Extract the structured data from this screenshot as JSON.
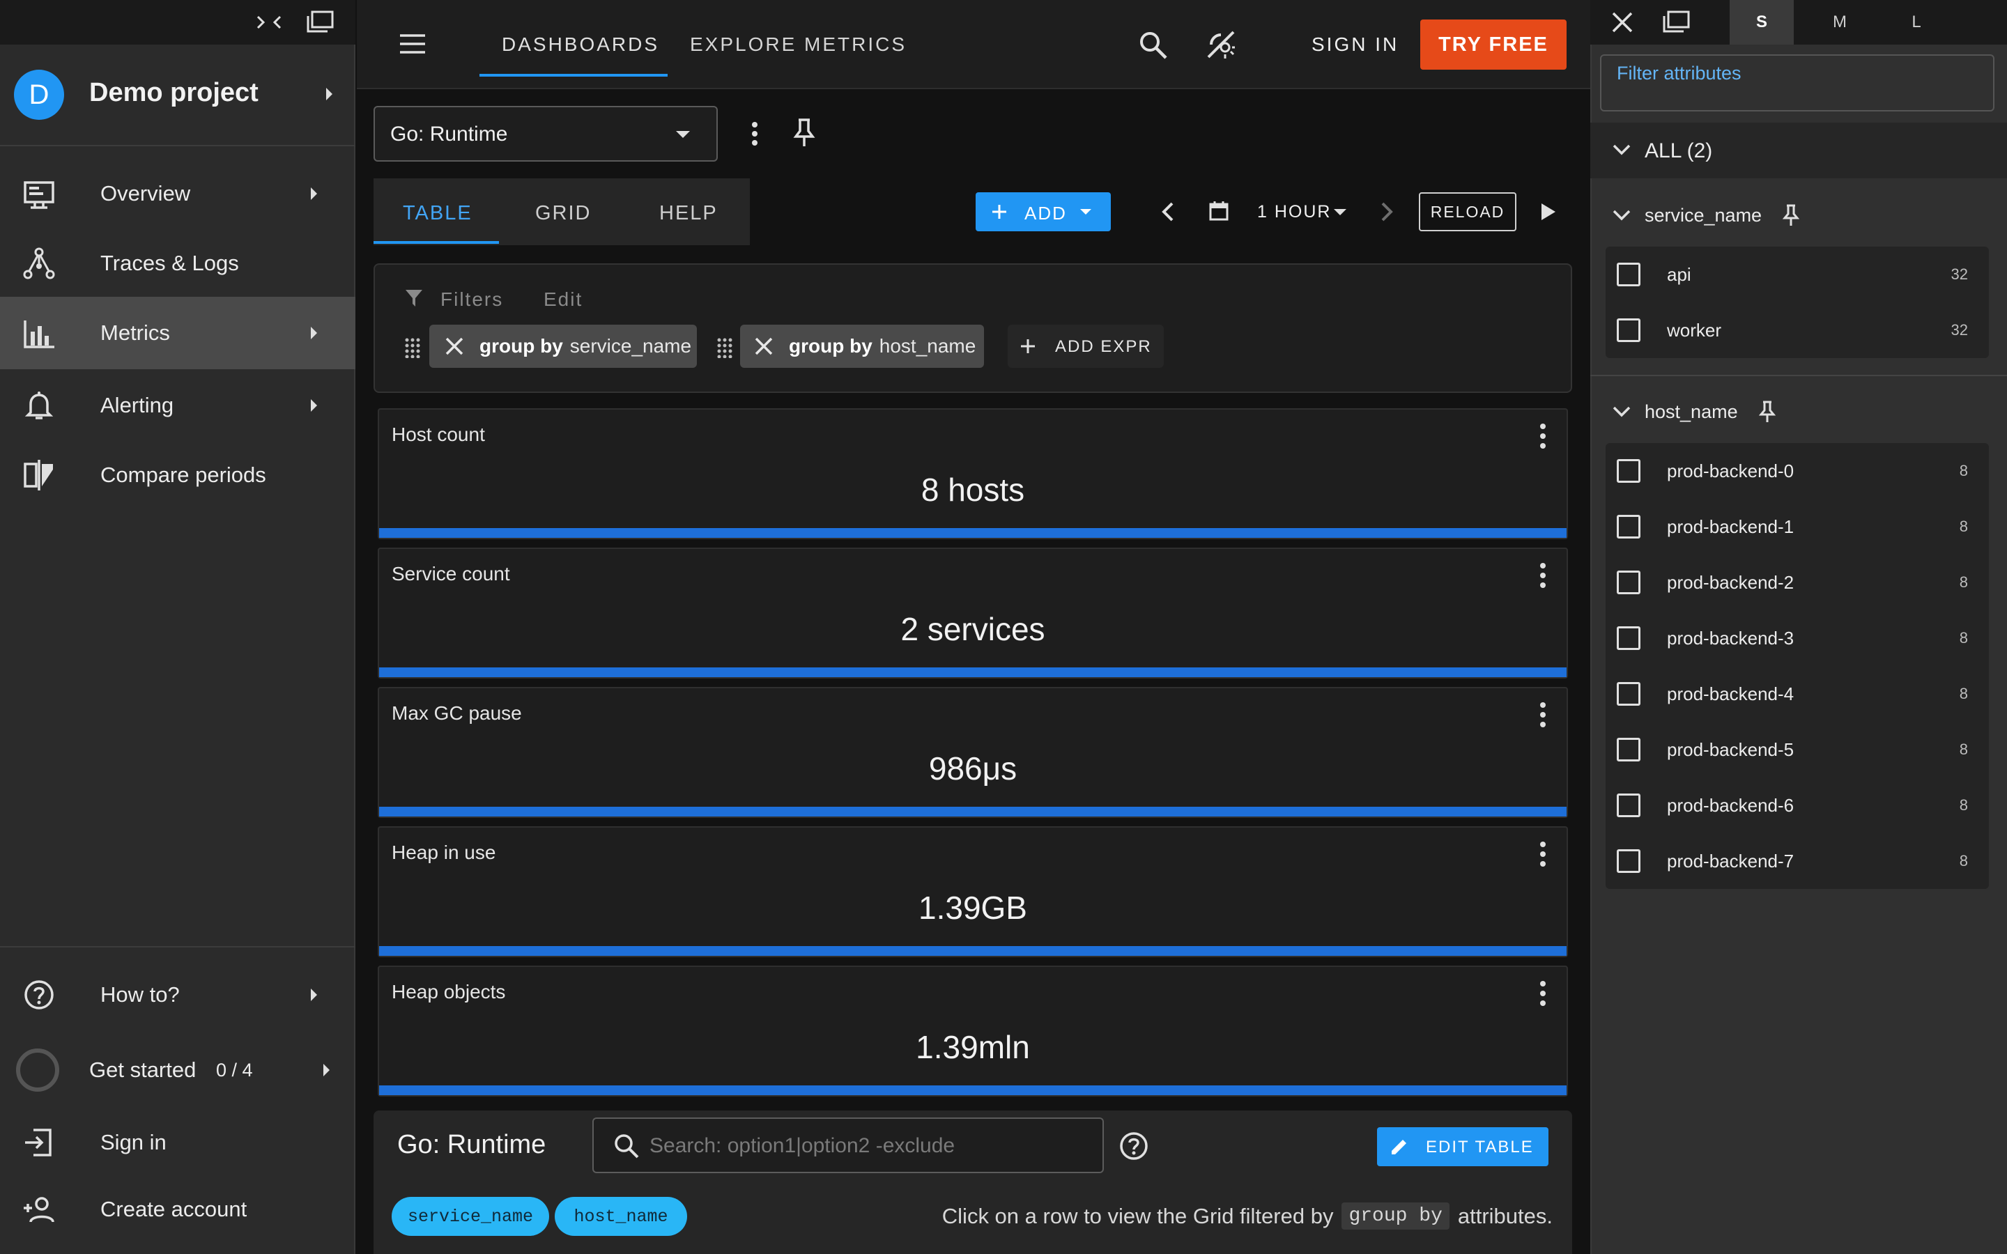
{
  "sidebar": {
    "project_initial": "D",
    "project_name": "Demo project",
    "items": [
      {
        "label": "Overview",
        "icon": "monitor-icon"
      },
      {
        "label": "Traces & Logs",
        "icon": "traces-icon"
      },
      {
        "label": "Metrics",
        "icon": "bar-chart-icon",
        "active": true
      },
      {
        "label": "Alerting",
        "icon": "bell-icon"
      },
      {
        "label": "Compare periods",
        "icon": "compare-icon"
      }
    ],
    "bottom": {
      "how_to": "How to?",
      "get_started": "Get started",
      "get_started_progress": "0 / 4",
      "sign_in": "Sign in",
      "create_account": "Create account"
    }
  },
  "topnav": {
    "tabs": [
      "DASHBOARDS",
      "EXPLORE METRICS"
    ],
    "active_tab": "DASHBOARDS",
    "sign_in": "SIGN IN",
    "try_free": "TRY FREE"
  },
  "dashboard": {
    "selected": "Go: Runtime",
    "view_tabs": [
      "TABLE",
      "GRID",
      "HELP"
    ],
    "active_view": "TABLE",
    "add_label": "ADD",
    "period": "1 HOUR",
    "reload": "RELOAD"
  },
  "filters": {
    "label": "Filters",
    "edit": "Edit",
    "chips": [
      {
        "prefix": "group by",
        "value": "service_name"
      },
      {
        "prefix": "group by",
        "value": "host_name"
      }
    ],
    "add_expr": "ADD EXPR"
  },
  "cards": [
    {
      "title": "Host count",
      "value": "8 hosts"
    },
    {
      "title": "Service count",
      "value": "2 services"
    },
    {
      "title": "Max GC pause",
      "value": "986μs"
    },
    {
      "title": "Heap in use",
      "value": "1.39GB"
    },
    {
      "title": "Heap objects",
      "value": "1.39mln"
    }
  ],
  "table_panel": {
    "title": "Go: Runtime",
    "search_placeholder": "Search: option1|option2 -exclude",
    "edit_table": "EDIT TABLE",
    "pills": [
      "service_name",
      "host_name"
    ],
    "hint_prefix": "Click on a row to view the Grid filtered by",
    "hint_code": "group by",
    "hint_suffix": "attributes."
  },
  "right_panel": {
    "size_tabs": [
      "S",
      "M",
      "L"
    ],
    "active_size": "S",
    "filter_placeholder": "Filter attributes",
    "all_label": "ALL (2)",
    "groups": [
      {
        "name": "service_name",
        "items": [
          {
            "label": "api",
            "count": "32"
          },
          {
            "label": "worker",
            "count": "32"
          }
        ]
      },
      {
        "name": "host_name",
        "items": [
          {
            "label": "prod-backend-0",
            "count": "8"
          },
          {
            "label": "prod-backend-1",
            "count": "8"
          },
          {
            "label": "prod-backend-2",
            "count": "8"
          },
          {
            "label": "prod-backend-3",
            "count": "8"
          },
          {
            "label": "prod-backend-4",
            "count": "8"
          },
          {
            "label": "prod-backend-5",
            "count": "8"
          },
          {
            "label": "prod-backend-6",
            "count": "8"
          },
          {
            "label": "prod-backend-7",
            "count": "8"
          }
        ]
      }
    ]
  },
  "colors": {
    "accent": "#2196f3",
    "try_free": "#e64a19",
    "card_bar": "#1e6fd9",
    "pill": "#29b6f6"
  }
}
